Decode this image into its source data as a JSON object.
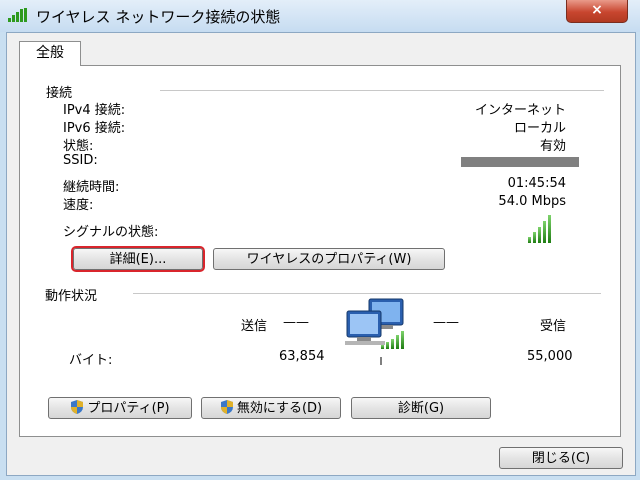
{
  "window": {
    "title": "ワイヤレス ネットワーク接続の状態",
    "close_glyph": "×"
  },
  "tabs": [
    {
      "label": "全般"
    }
  ],
  "connection": {
    "section_title": "接続",
    "rows": [
      {
        "label": "IPv4 接続:",
        "value": "インターネット"
      },
      {
        "label": "IPv6 接続:",
        "value": "ローカル"
      },
      {
        "label": "状態:",
        "value": "有効"
      },
      {
        "label": "SSID:",
        "value": ""
      },
      {
        "label": "継続時間:",
        "value": "01:45:54"
      },
      {
        "label": "速度:",
        "value": "54.0 Mbps"
      }
    ],
    "signal_label": "シグナルの状態:",
    "signal_bars": 5,
    "details_button": "詳細(E)...",
    "wireless_properties_button": "ワイヤレスのプロパティ(W)"
  },
  "activity": {
    "section_title": "動作状況",
    "sent_label": "送信",
    "received_label": "受信",
    "dash": "——",
    "bytes_label": "バイト:",
    "bytes_sent": "63,854",
    "bytes_received": "55,000"
  },
  "buttons": {
    "properties": "プロパティ(P)",
    "disable": "無効にする(D)",
    "diagnose": "診断(G)",
    "close": "閉じる(C)"
  },
  "colors": {
    "accent_focus": "#d9252c",
    "signal_green": "#2e9a1f",
    "title_bg": "#c6dcf1"
  }
}
